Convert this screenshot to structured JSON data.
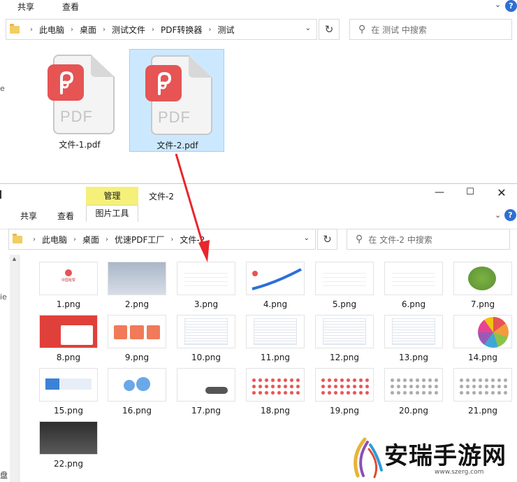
{
  "window_top": {
    "tabs": [
      "共享",
      "查看"
    ],
    "breadcrumbs": [
      "此电脑",
      "桌面",
      "测试文件",
      "PDF转换器",
      "测试"
    ],
    "search_placeholder": "在 测试 中搜索",
    "files": [
      {
        "name": "文件-1.pdf",
        "selected": false
      },
      {
        "name": "文件-2.pdf",
        "selected": true
      }
    ],
    "pdf_badge_text": "PDF"
  },
  "window_bottom": {
    "title": "文件-2",
    "context_tab": "管理",
    "context_group": "图片工具",
    "tabs": [
      "共享",
      "查看"
    ],
    "breadcrumbs": [
      "此电脑",
      "桌面",
      "优速PDF工厂",
      "文件-2"
    ],
    "search_placeholder": "在 文件-2 中搜索",
    "images": [
      "1.png",
      "2.png",
      "3.png",
      "4.png",
      "5.png",
      "6.png",
      "7.png",
      "8.png",
      "9.png",
      "10.png",
      "11.png",
      "12.png",
      "13.png",
      "14.png",
      "15.png",
      "16.png",
      "17.png",
      "18.png",
      "19.png",
      "20.png",
      "21.png",
      "22.png"
    ],
    "thumb_caption_1": "中国有赞"
  },
  "left_edge_chars": [
    "e",
    "ie",
    "盘 ("
  ],
  "watermark": {
    "title": "安瑞手游网",
    "url": "www.szerg.com"
  },
  "colors": {
    "accent_red": "#e65454",
    "selection_bg": "#cce8ff",
    "context_tab_bg": "#f5f07a",
    "arrow_red": "#e8262c"
  }
}
